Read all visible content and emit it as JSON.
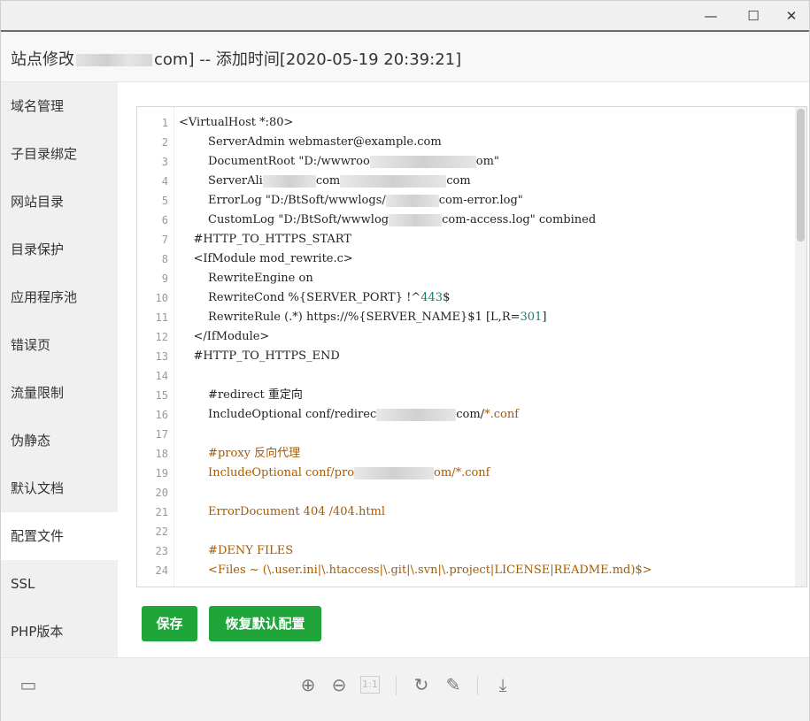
{
  "window": {
    "title_prefix": "站点修改",
    "title_suffix": "com] -- 添加时间[2020-05-19 20:39:21]",
    "controls": {
      "minimize": "—",
      "maximize": "☐",
      "close": "✕"
    }
  },
  "sidebar": {
    "items": [
      {
        "label": "域名管理"
      },
      {
        "label": "子目录绑定"
      },
      {
        "label": "网站目录"
      },
      {
        "label": "目录保护"
      },
      {
        "label": "应用程序池"
      },
      {
        "label": "错误页"
      },
      {
        "label": "流量限制"
      },
      {
        "label": "伪静态"
      },
      {
        "label": "默认文档"
      },
      {
        "label": "配置文件"
      },
      {
        "label": "SSL"
      },
      {
        "label": "PHP版本"
      }
    ],
    "active": "配置文件"
  },
  "editor": {
    "line_numbers": [
      "1",
      "2",
      "3",
      "4",
      "5",
      "6",
      "7",
      "8",
      "9",
      "10",
      "11",
      "12",
      "13",
      "14",
      "15",
      "16",
      "17",
      "18",
      "19",
      "20",
      "21",
      "22",
      "23",
      "24"
    ],
    "lines": [
      {
        "a": "<VirtualHost *:80>"
      },
      {
        "a": "        ServerAdmin webmaster@example.com"
      },
      {
        "a": "        DocumentRoot \"D:/wwwroo",
        "b": "om\""
      },
      {
        "a": "        ServerAli",
        "b": "com",
        "c": "com"
      },
      {
        "a": "        ErrorLog \"D:/BtSoft/wwwlogs/",
        "b": "com-error.log\""
      },
      {
        "a": "        CustomLog \"D:/BtSoft/wwwlog",
        "b": "com-access.log\" combined"
      },
      {
        "a": "    #HTTP_TO_HTTPS_START"
      },
      {
        "a": "    <IfModule mod_rewrite.c>"
      },
      {
        "a": "        RewriteEngine on"
      },
      {
        "a": "        RewriteCond %{SERVER_PORT} !^",
        "num": "443",
        "b": "$"
      },
      {
        "a": "        RewriteRule (.*) https://%{SERVER_NAME}$1 [L,R=",
        "num": "301",
        "b": "]"
      },
      {
        "a": "    </IfModule>"
      },
      {
        "a": "    #HTTP_TO_HTTPS_END"
      },
      {
        "a": ""
      },
      {
        "a": "        #redirect 重定向"
      },
      {
        "a": "        IncludeOptional conf/redirec",
        "b": "com/",
        "path": "*.conf"
      },
      {
        "a": ""
      },
      {
        "a": "        #proxy 反向代理"
      },
      {
        "a": "        IncludeOptional conf/pro",
        "b": "om/*.conf"
      },
      {
        "a": ""
      },
      {
        "a": "        ErrorDocument 404 /404.html"
      },
      {
        "a": ""
      },
      {
        "a": "        #DENY FILES"
      },
      {
        "a": "        <Files ~ (\\.user.ini|\\.htaccess|\\.git|\\.svn|\\.project|LICENSE|README.md)$>"
      }
    ]
  },
  "buttons": {
    "save": "保存",
    "reset": "恢复默认配置"
  },
  "toolbar": {
    "layout_icon": "▭",
    "zoom_in_icon": "⊕",
    "zoom_out_icon": "⊖",
    "actual_size_icon": "1:1",
    "rotate_icon": "↻",
    "edit_icon": "✎",
    "download_icon": "⤓"
  }
}
